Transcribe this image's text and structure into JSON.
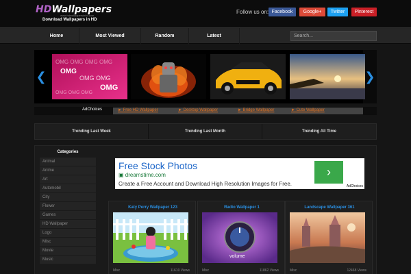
{
  "header": {
    "logo_hd": "HD",
    "logo_wallpapers": "Wallpapers",
    "logo_url": "www.hdwallpapersinhd.com",
    "tagline": "Download Wallpapers in HD",
    "follow_label": "Follow us on:",
    "social": [
      {
        "label": "Facebook",
        "color": "#3b5998"
      },
      {
        "label": "Google+",
        "color": "#dd4b39"
      },
      {
        "label": "Twitter",
        "color": "#1da1f2"
      },
      {
        "label": "Pinterest",
        "color": "#cb2027"
      }
    ]
  },
  "nav": {
    "items": [
      "Home",
      "Most Viewed",
      "Random",
      "Latest"
    ],
    "search_placeholder": "Search..."
  },
  "slider": {
    "prev_icon": "chevron-left-icon",
    "next_icon": "chevron-right-icon",
    "thumbnails": [
      "omg-pink-text",
      "flaming-robot",
      "yellow-mustang",
      "coastal-sunset"
    ]
  },
  "ad_strip": {
    "adchoices": "AdChoices",
    "links": [
      "► Free HD Wallpaper",
      "► Desktop Wallpaper",
      "► Bridge Wallpaper",
      "► Cute Wallpaper"
    ]
  },
  "trending": [
    "Trending Last Week",
    "Trending Last Month",
    "Trending All Time"
  ],
  "categories": {
    "title": "Categories",
    "items": [
      "Animal",
      "Anime",
      "Art",
      "Automobil",
      "City",
      "Flower",
      "Games",
      "HD Wallpaper",
      "Logo",
      "Misc",
      "Movie",
      "Music"
    ]
  },
  "big_ad": {
    "title": "Free Stock Photos",
    "domain": "dreamstime.com",
    "description": "Create a Free Account and Download High Resolution Images for Free.",
    "adchoices": "AdChoices"
  },
  "cards": [
    {
      "title": "Katy Perry Wallpaper 123",
      "category": "Misc",
      "views": "11610 Views"
    },
    {
      "title": "Radio Wallpaper 1",
      "category": "Misc",
      "views": "11862 Views"
    },
    {
      "title": "Landscape Wallpaper 361",
      "category": "Misc",
      "views": "12468 Views"
    }
  ]
}
